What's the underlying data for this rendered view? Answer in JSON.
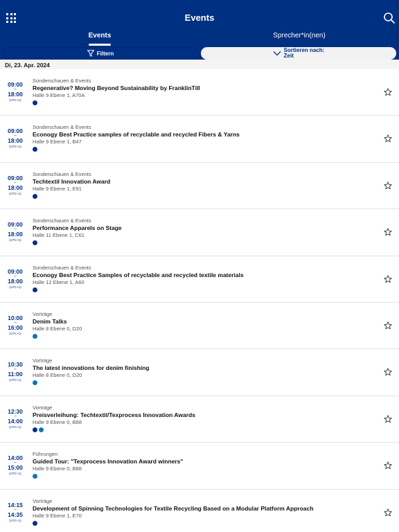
{
  "header": {
    "title": "Events",
    "tabs": [
      "Events",
      "Sprecher*in(nen)"
    ]
  },
  "toolbar": {
    "filter_label": "Filtern",
    "sort_label_line1": "Sortieren nach:",
    "sort_label_line2": "Zeit"
  },
  "date_label": "Di, 23. Apr. 2024",
  "timezone_label": "(UTC+1)",
  "colors": {
    "brand": "#003082",
    "dot_dark": "#003082",
    "dot_light": "#0a75b8"
  },
  "events": [
    {
      "start": "09:00",
      "end": "18:00",
      "category": "Sonderschauen & Events",
      "name": "Regenerative? Moving Beyond Sustainability by FranklinTill",
      "location": "Halle 9 Ebene 1, A70A",
      "dots": [
        "dark"
      ]
    },
    {
      "start": "09:00",
      "end": "18:00",
      "category": "Sonderschauen & Events",
      "name": "Econogy Best Practice samples of recyclable and recycled Fibers & Yarns",
      "location": "Halle 9 Ebene 1, B47",
      "dots": [
        "dark"
      ]
    },
    {
      "start": "09:00",
      "end": "18:00",
      "category": "Sonderschauen & Events",
      "name": "Techtextil Innovation Award",
      "location": "Halle 9 Ebene 1, E91",
      "dots": [
        "dark"
      ]
    },
    {
      "start": "09:00",
      "end": "18:00",
      "category": "Sonderschauen & Events",
      "name": "Performance Apparels on Stage",
      "location": "Halle 11 Ebene 1, C61",
      "dots": [
        "dark"
      ]
    },
    {
      "start": "09:00",
      "end": "18:00",
      "category": "Sonderschauen & Events",
      "name": "Econogy Best Practice Samples of recyclable and recycled textile materials",
      "location": "Halle 12 Ebene 1, A60",
      "dots": [
        "dark"
      ]
    },
    {
      "start": "10:00",
      "end": "16:00",
      "category": "Vorträge",
      "name": "Denim Talks",
      "location": "Halle 8 Ebene 0, D20",
      "dots": [
        "light"
      ]
    },
    {
      "start": "10:30",
      "end": "11:00",
      "category": "Vorträge",
      "name": "The latest innovations for denim finishing",
      "location": "Halle 8 Ebene 0, D20",
      "dots": [
        "light"
      ]
    },
    {
      "start": "12:30",
      "end": "14:00",
      "category": "Vorträge",
      "name": "Preisverleihung: Techtextil/Texprocess Innovation Awards",
      "location": "Halle 9 Ebene 0, B88",
      "dots": [
        "dark",
        "light"
      ]
    },
    {
      "start": "14:00",
      "end": "15:00",
      "category": "Führungen",
      "name": "Guided Tour: \"Texprocess Innovation Award winners\"",
      "location": "Halle 9 Ebene 0, B88",
      "dots": [
        "light"
      ]
    },
    {
      "start": "14:15",
      "end": "14:35",
      "category": "Vorträge",
      "name": "Development of Spinning Technologies for Textile Recycling Based on a Modular Platform Approach",
      "location": "Halle 9 Ebene 1, E70",
      "dots": [
        "dark"
      ]
    }
  ]
}
